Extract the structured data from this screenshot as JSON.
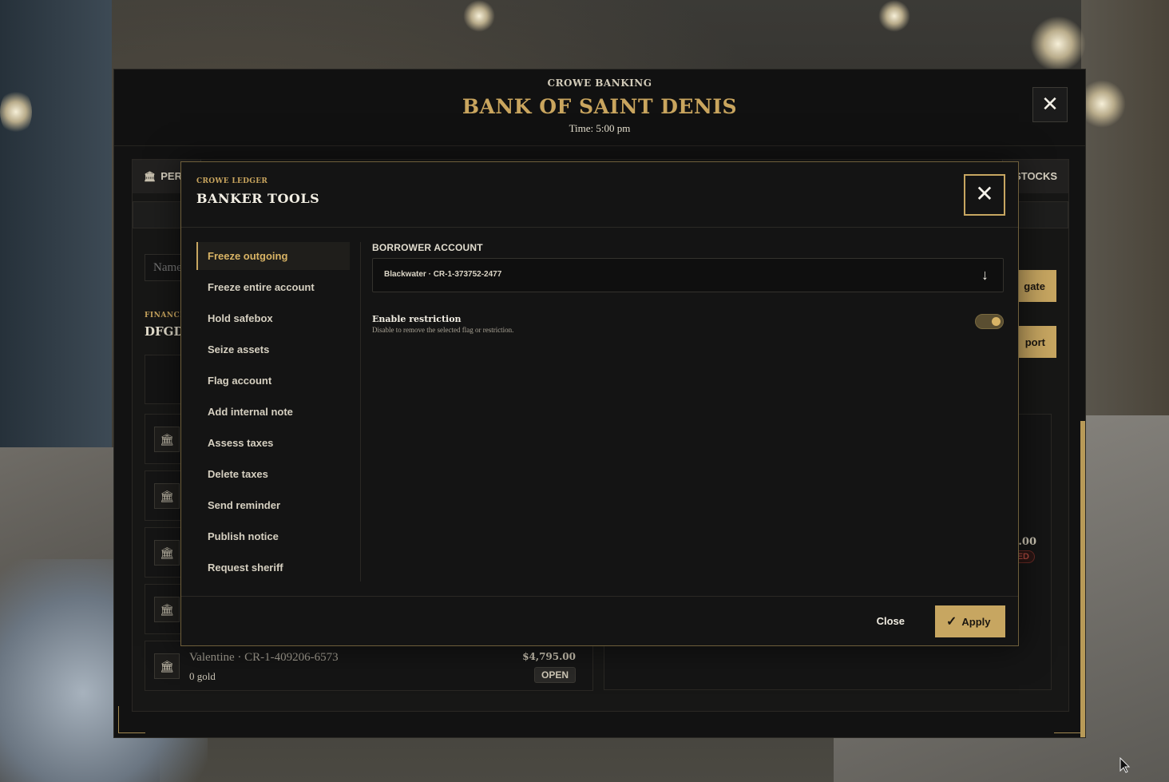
{
  "bank": {
    "brand": "CROWE BANKING",
    "title": "BANK OF SAINT DENIS",
    "time": "Time: 5:00 pm",
    "close_icon": "close-icon"
  },
  "tabs": {
    "first": "PERS",
    "last": "STOCKS"
  },
  "search": {
    "placeholder": "Name"
  },
  "side_buttons": {
    "one": "gate",
    "two": "port"
  },
  "financial": {
    "label": "FINANCIA",
    "value": "DFGDI"
  },
  "accounts": [
    {
      "name": "",
      "gold": "",
      "amount": "",
      "status": ""
    },
    {
      "name": "",
      "gold": "",
      "amount": "",
      "status": ""
    },
    {
      "name": "",
      "gold": "",
      "amount": "",
      "status": ""
    },
    {
      "name": "",
      "gold": "",
      "amount": "",
      "status": ""
    },
    {
      "name": "Valentine · CR-1-409206-6573",
      "gold": "0 gold",
      "amount": "$4,795.00",
      "status": "OPEN"
    }
  ],
  "right_panel": {
    "amount": ".00",
    "badge": "ED"
  },
  "modal": {
    "brand": "CROWE LEDGER",
    "title": "BANKER TOOLS",
    "nav": [
      {
        "label": "Freeze outgoing",
        "active": true
      },
      {
        "label": "Freeze entire account"
      },
      {
        "label": "Hold safebox"
      },
      {
        "label": "Seize assets"
      },
      {
        "label": "Flag account"
      },
      {
        "label": "Add internal note"
      },
      {
        "label": "Assess taxes"
      },
      {
        "label": "Delete taxes"
      },
      {
        "label": "Send reminder"
      },
      {
        "label": "Publish notice"
      },
      {
        "label": "Request sheriff"
      }
    ],
    "borrower_label": "BORROWER ACCOUNT",
    "borrower_value": "Blackwater · CR-1-373752-2477",
    "toggle_title": "Enable restriction",
    "toggle_desc": "Disable to remove the selected flag or restriction.",
    "toggle_on": true,
    "close_label": "Close",
    "apply_label": "Apply"
  },
  "colors": {
    "accent": "#c7a661",
    "panel": "#141414"
  }
}
